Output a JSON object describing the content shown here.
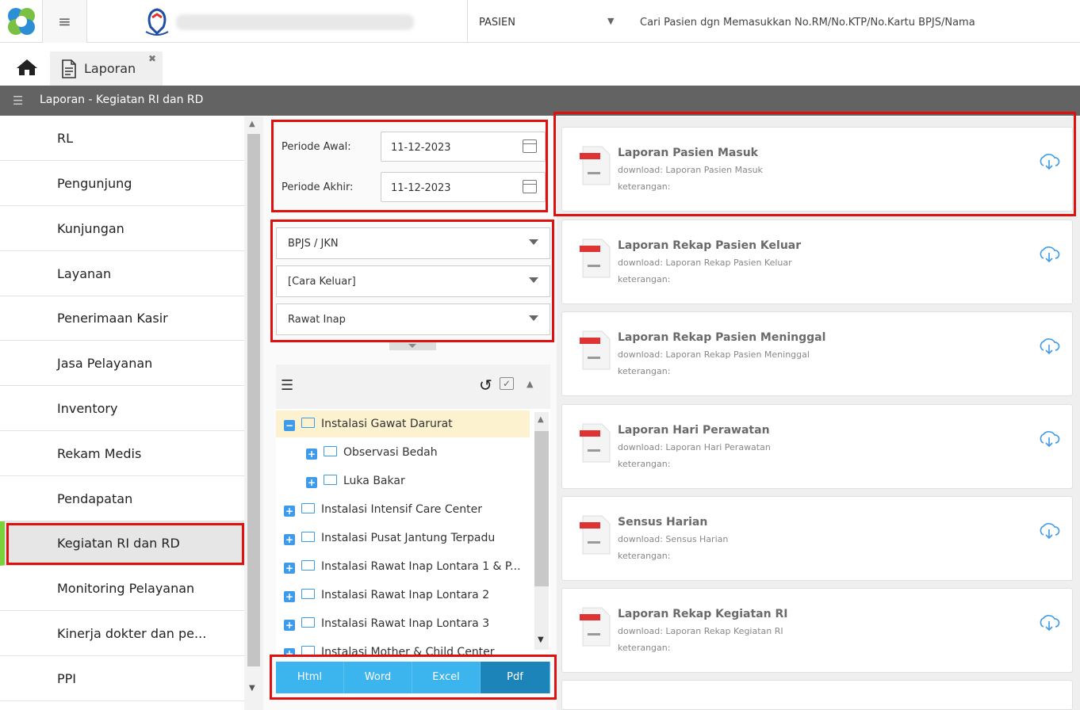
{
  "topbar": {
    "patient_select": "PASIEN",
    "search_placeholder": "Cari Pasien dgn Memasukkan No.RM/No.KTP/No.Kartu BPJS/Nama"
  },
  "tab": {
    "label": "Laporan"
  },
  "header": {
    "title": "Laporan - Kegiatan RI dan RD"
  },
  "sidebar": {
    "items": [
      {
        "label": "RL"
      },
      {
        "label": "Pengunjung"
      },
      {
        "label": "Kunjungan"
      },
      {
        "label": "Layanan"
      },
      {
        "label": "Penerimaan Kasir"
      },
      {
        "label": "Jasa Pelayanan"
      },
      {
        "label": "Inventory"
      },
      {
        "label": "Rekam Medis"
      },
      {
        "label": "Pendapatan"
      },
      {
        "label": "Kegiatan RI dan RD"
      },
      {
        "label": "Monitoring Pelayanan"
      },
      {
        "label": "Kinerja dokter dan pe..."
      },
      {
        "label": "PPI"
      }
    ]
  },
  "filters": {
    "periode_awal_label": "Periode Awal:",
    "periode_awal": "11-12-2023",
    "periode_akhir_label": "Periode Akhir:",
    "periode_akhir": "11-12-2023",
    "penjamin": "BPJS / JKN",
    "cara_keluar": "[Cara Keluar]",
    "jenis_rawat": "Rawat Inap"
  },
  "tree": {
    "nodes": [
      {
        "label": "Instalasi Gawat Darurat"
      },
      {
        "label": "Observasi Bedah"
      },
      {
        "label": "Luka Bakar"
      },
      {
        "label": "Instalasi Intensif Care Center"
      },
      {
        "label": "Instalasi Pusat Jantung Terpadu"
      },
      {
        "label": "Instalasi Rawat Inap Lontara 1 & P..."
      },
      {
        "label": "Instalasi Rawat Inap Lontara 2"
      },
      {
        "label": "Instalasi Rawat Inap Lontara 3"
      },
      {
        "label": "Instalasi Mother & Child Center"
      }
    ]
  },
  "export": {
    "html": "Html",
    "word": "Word",
    "excel": "Excel",
    "pdf": "Pdf"
  },
  "reports": [
    {
      "title": "Laporan Pasien Masuk",
      "download": "download: Laporan Pasien Masuk",
      "ket": "keterangan:"
    },
    {
      "title": "Laporan Rekap Pasien Keluar",
      "download": "download: Laporan Rekap Pasien Keluar",
      "ket": "keterangan:"
    },
    {
      "title": "Laporan Rekap Pasien Meninggal",
      "download": "download: Laporan Rekap Pasien Meninggal",
      "ket": "keterangan:"
    },
    {
      "title": "Laporan Hari Perawatan",
      "download": "download: Laporan Hari Perawatan",
      "ket": "keterangan:"
    },
    {
      "title": "Sensus Harian",
      "download": "download: Sensus Harian",
      "ket": "keterangan:"
    },
    {
      "title": "Laporan Rekap Kegiatan RI",
      "download": "download: Laporan Rekap Kegiatan RI",
      "ket": "keterangan:"
    }
  ],
  "colors": {
    "accent": "#3cb4ee",
    "highlight": "#e01010",
    "active": "#7bd13a",
    "header": "#636363"
  }
}
